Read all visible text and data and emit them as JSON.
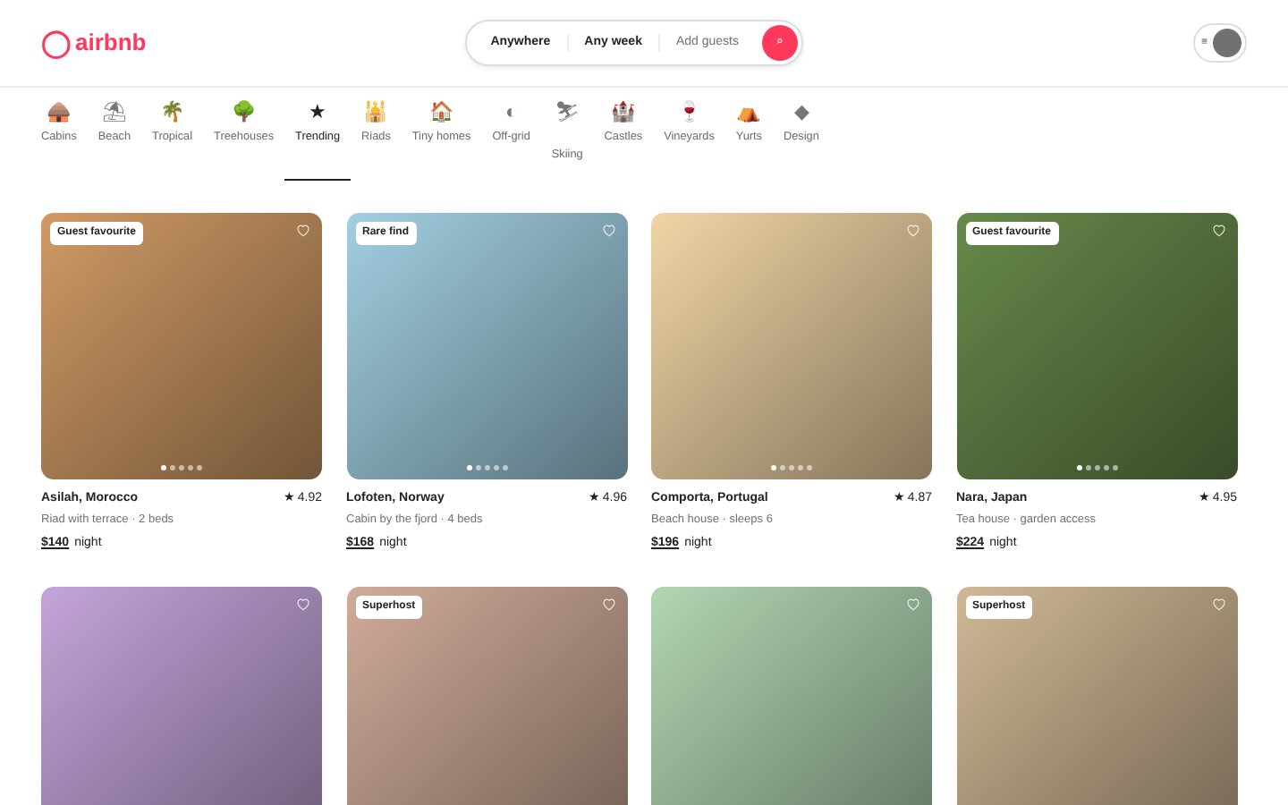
{
  "logo": {
    "mark": "◯",
    "text": "airbnb"
  },
  "search": {
    "segments": [
      {
        "label": "Anywhere",
        "kind": "value"
      },
      {
        "label": "Any week",
        "kind": "value"
      },
      {
        "label": "Add guests",
        "kind": "placeholder"
      }
    ],
    "button": "⌕"
  },
  "profile": {
    "menu": "≡"
  },
  "categories": [
    {
      "icon": "🛖",
      "label": "Cabins",
      "selected": false
    },
    {
      "icon": "⛱",
      "label": "Beach",
      "selected": false
    },
    {
      "icon": "🌴",
      "label": "Tropical",
      "selected": false
    },
    {
      "icon": "🌳",
      "label": "Treehouses",
      "selected": false
    },
    {
      "icon": "★",
      "label": "Trending",
      "selected": true
    },
    {
      "icon": "🕌",
      "label": "Riads",
      "selected": false
    },
    {
      "icon": "🏠",
      "label": "Tiny homes",
      "selected": false
    },
    {
      "icon": "◐",
      "label": "Off-grid",
      "selected": false
    },
    {
      "icon": "⛷",
      "label": "Skiing",
      "selected": false
    },
    {
      "icon": "🏰",
      "label": "Castles",
      "selected": false
    },
    {
      "icon": "🍷",
      "label": "Vineyards",
      "selected": false
    },
    {
      "icon": "⛺",
      "label": "Yurts",
      "selected": false
    },
    {
      "icon": "◆",
      "label": "Design",
      "selected": false
    }
  ],
  "listings": [
    {
      "badge": "Guest favourite",
      "color": "#d09a66",
      "dots": [
        {
          "selected": true
        },
        {
          "selected": false
        },
        {
          "selected": false
        },
        {
          "selected": false
        },
        {
          "selected": false
        }
      ],
      "title": "Asilah, Morocco",
      "rating": "★ 4.92",
      "subtitle": "Riad with terrace · 2 beds",
      "price": "$140",
      "unit": "night"
    },
    {
      "badge": "Rare find",
      "color": "#a2cfe2",
      "dots": [
        {
          "selected": true
        },
        {
          "selected": false
        },
        {
          "selected": false
        },
        {
          "selected": false
        },
        {
          "selected": false
        }
      ],
      "title": "Lofoten, Norway",
      "rating": "★ 4.96",
      "subtitle": "Cabin by the fjord · 4 beds",
      "price": "$168",
      "unit": "night"
    },
    {
      "color": "#f1d5a6",
      "dots": [
        {
          "selected": true
        },
        {
          "selected": false
        },
        {
          "selected": false
        },
        {
          "selected": false
        },
        {
          "selected": false
        }
      ],
      "title": "Comporta, Portugal",
      "rating": "★ 4.87",
      "subtitle": "Beach house · sleeps 6",
      "price": "$196",
      "unit": "night"
    },
    {
      "badge": "Guest favourite",
      "color": "#67894a",
      "dots": [
        {
          "selected": true
        },
        {
          "selected": false
        },
        {
          "selected": false
        },
        {
          "selected": false
        },
        {
          "selected": false
        }
      ],
      "title": "Nara, Japan",
      "rating": "★ 4.95",
      "subtitle": "Tea house · garden access",
      "price": "$224",
      "unit": "night"
    },
    {
      "color": "#c4a5db"
    },
    {
      "badge": "Superhost",
      "color": "#d0ac99"
    },
    {
      "color": "#b2d6b2"
    },
    {
      "badge": "Superhost",
      "color": "#d0b895"
    }
  ]
}
